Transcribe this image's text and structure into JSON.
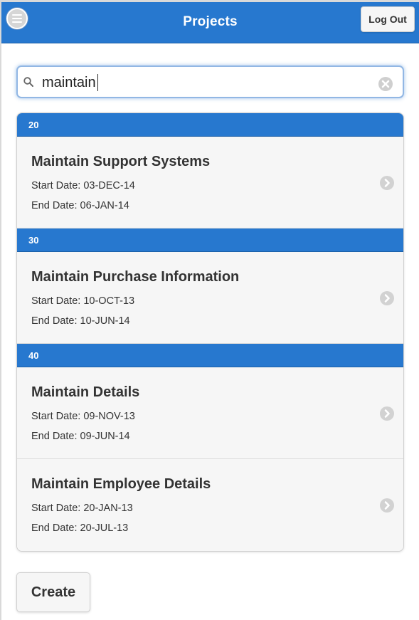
{
  "header": {
    "title": "Projects",
    "menu_icon": "hamburger-menu-icon",
    "logout_label": "Log Out"
  },
  "search": {
    "value": "maintain",
    "search_icon": "search-icon",
    "clear_icon": "clear-icon"
  },
  "groups": [
    {
      "divider": "20",
      "items": [
        {
          "title": "Maintain Support Systems",
          "start": "Start Date: 03-DEC-14",
          "end": "End Date: 06-JAN-14"
        }
      ]
    },
    {
      "divider": "30",
      "items": [
        {
          "title": "Maintain Purchase Information",
          "start": "Start Date: 10-OCT-13",
          "end": "End Date: 10-JUN-14"
        }
      ]
    },
    {
      "divider": "40",
      "items": [
        {
          "title": "Maintain Details",
          "start": "Start Date: 09-NOV-13",
          "end": "End Date: 09-JUN-14"
        },
        {
          "title": "Maintain Employee Details",
          "start": "Start Date: 20-JAN-13",
          "end": "End Date: 20-JUL-13"
        }
      ]
    }
  ],
  "footer": {
    "create_label": "Create"
  },
  "colors": {
    "header": "#2778cf",
    "divider": "#2778cf",
    "list_bg": "#f6f6f6"
  }
}
